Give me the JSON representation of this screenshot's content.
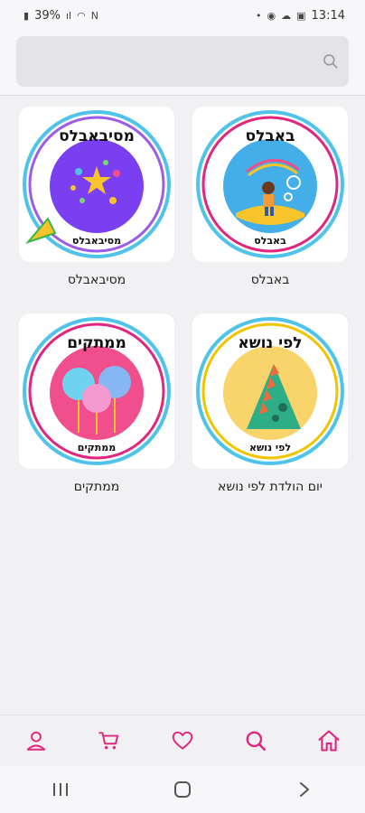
{
  "status_bar": {
    "battery": "39%",
    "time": "13:14"
  },
  "search": {
    "placeholder": ""
  },
  "categories": [
    {
      "label": "מסיבאבלס",
      "badge_title": "מסיבאבלס",
      "badge_subtitle": "מסיבאבלס",
      "ring_color": "#9b5de5",
      "inner_color": "#7b3ff2"
    },
    {
      "label": "באבלס",
      "badge_title": "באבלס",
      "badge_subtitle": "באבלס",
      "ring_color": "#e1267f",
      "inner_color": "#44aee8"
    },
    {
      "label": "ממתקים",
      "badge_title": "ממתקים",
      "badge_subtitle": "ממתקים",
      "ring_color": "#e1267f",
      "inner_color": "#f04e8c"
    },
    {
      "label": "יום הולדת לפי נושא",
      "badge_title": "לפי נושא",
      "badge_subtitle": "לפי נושא",
      "ring_color": "#f2c400",
      "inner_color": "#f9d46a"
    }
  ],
  "bottom_nav": {
    "icons": [
      "user-icon",
      "cart-icon",
      "heart-icon",
      "search-icon",
      "home-icon"
    ],
    "accent_color": "#e1267f"
  }
}
